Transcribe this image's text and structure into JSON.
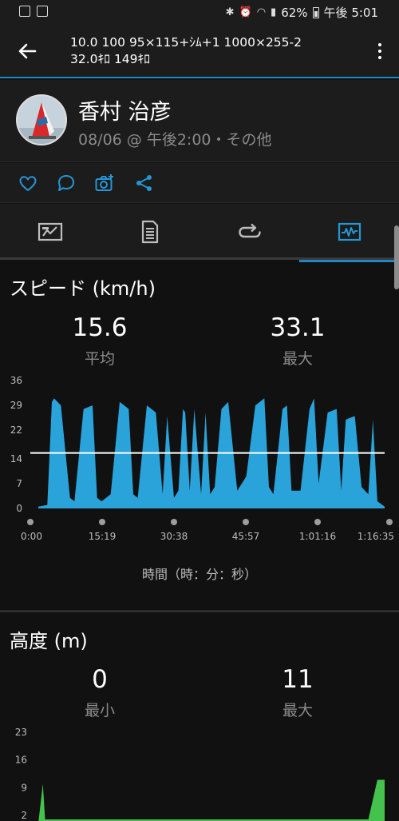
{
  "status_bar": {
    "battery": "62%",
    "time": "午後 5:01"
  },
  "header": {
    "title_line1": "10.0 100 95×115+ｼﾑ+1 1000×255-2",
    "title_line2": "32.0ｷﾛ 149ｷﾛ"
  },
  "profile": {
    "name": "香村 治彦",
    "meta": "08/06 @ 午後2:00・その他"
  },
  "tabs": [
    {
      "icon": "summary-icon",
      "active": false
    },
    {
      "icon": "details-icon",
      "active": false
    },
    {
      "icon": "laps-icon",
      "active": false
    },
    {
      "icon": "charts-icon",
      "active": true
    }
  ],
  "speed": {
    "title": "スピード (km/h)",
    "avg_value": "15.6",
    "avg_label": "平均",
    "max_value": "33.1",
    "max_label": "最大",
    "x_axis_title": "時間（時：分：秒）"
  },
  "elevation": {
    "title": "高度 (m)",
    "min_value": "0",
    "min_label": "最小",
    "max_value": "11",
    "max_label": "最大"
  },
  "colors": {
    "accent": "#1e88c7",
    "speed_fill": "#29a3da",
    "elevation_fill": "#44c24b",
    "background": "#111111",
    "panel": "#1c1c1c"
  },
  "chart_data": [
    {
      "type": "area",
      "title": "スピード (km/h)",
      "xlabel": "時間（時：分：秒）",
      "ylabel": "",
      "x_ticks": [
        "0:00",
        "15:19",
        "30:38",
        "45:57",
        "1:01:16",
        "1:16:35"
      ],
      "y_ticks": [
        0,
        7,
        14,
        22,
        29,
        36
      ],
      "ylim": [
        0,
        36
      ],
      "average_line": 15.6,
      "x_minutes": [
        0,
        2,
        3,
        3.5,
        5,
        7,
        8,
        10,
        12,
        13,
        14,
        16,
        18,
        20,
        21,
        22,
        24,
        26,
        27.5,
        28.5,
        30,
        31,
        32,
        32.5,
        33.5,
        34.5,
        36,
        37,
        38,
        39,
        40.5,
        42,
        44,
        45,
        46,
        48,
        50,
        51,
        52,
        54,
        55,
        56,
        58,
        60,
        61,
        62,
        64,
        66,
        67,
        68,
        70,
        71.5,
        73,
        74,
        75,
        76.6
      ],
      "values": [
        0.5,
        1,
        30,
        31,
        29,
        3,
        2,
        28,
        29,
        3,
        2,
        4,
        30,
        28,
        4,
        3,
        29,
        27,
        4,
        26,
        3,
        5,
        28,
        27,
        5,
        28,
        4,
        27,
        4,
        6,
        28,
        30,
        5,
        7,
        9,
        29,
        31,
        6,
        4,
        28,
        29,
        5,
        5,
        28,
        31,
        7,
        27,
        28,
        5,
        25,
        26,
        6,
        4,
        25,
        2,
        0.5
      ]
    },
    {
      "type": "area",
      "title": "高度 (m)",
      "y_ticks": [
        2,
        9,
        16,
        23
      ],
      "ylim": [
        0,
        23
      ],
      "x_minutes": [
        0,
        1,
        1.5,
        40,
        73,
        75,
        76.6
      ],
      "values": [
        0,
        10,
        1,
        1,
        1,
        11,
        11
      ]
    }
  ]
}
